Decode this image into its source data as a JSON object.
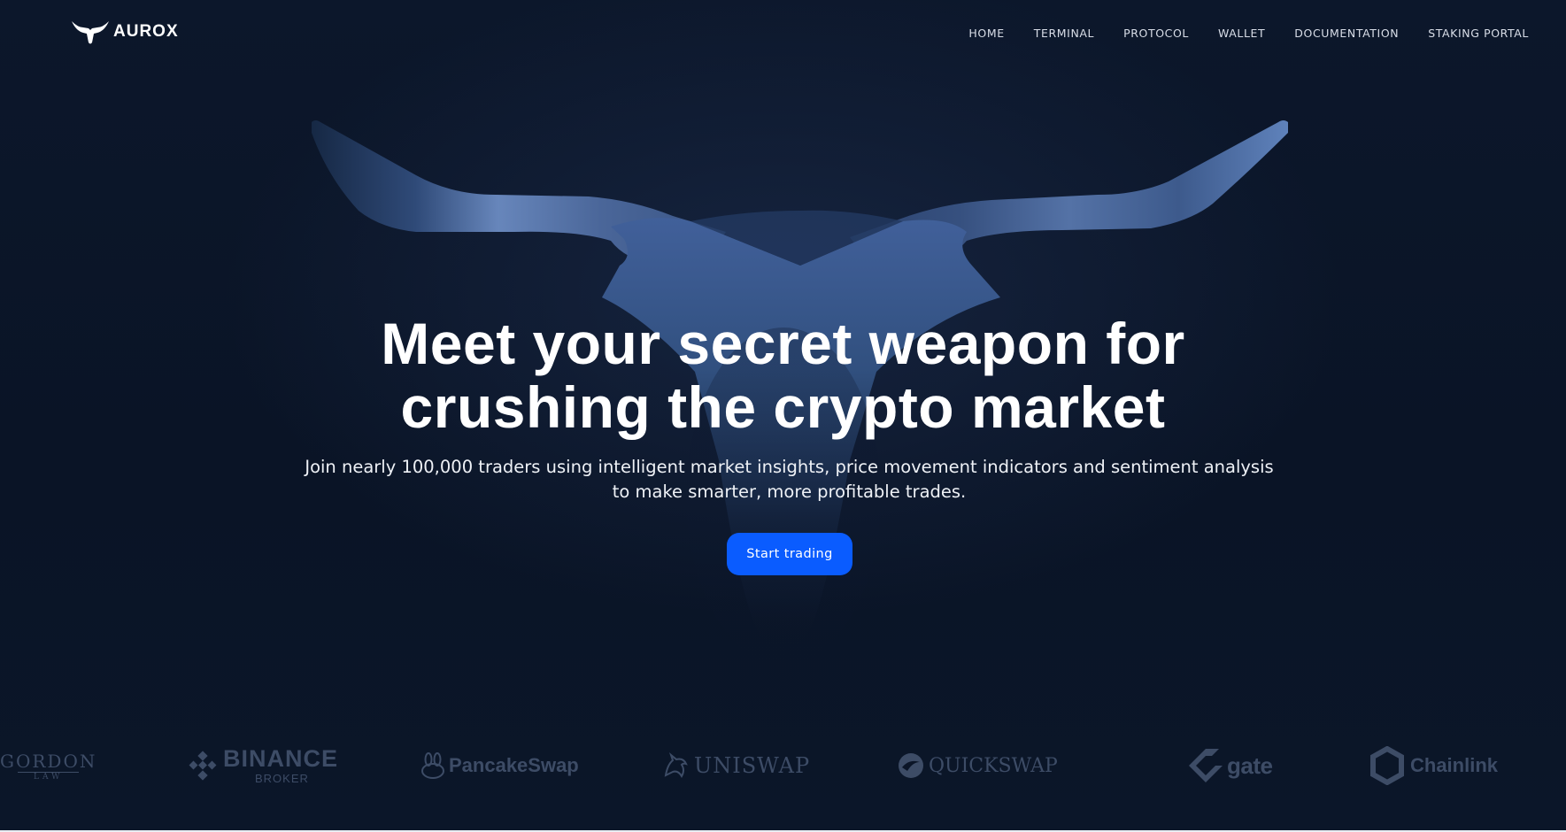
{
  "brand": {
    "name": "AUROX",
    "logo_icon": "bull-head-icon"
  },
  "nav": {
    "items": [
      {
        "label": "HOME"
      },
      {
        "label": "TERMINAL"
      },
      {
        "label": "PROTOCOL"
      },
      {
        "label": "WALLET"
      },
      {
        "label": "DOCUMENTATION"
      },
      {
        "label": "STAKING PORTAL"
      }
    ]
  },
  "hero": {
    "title_line1": "Meet your secret weapon for",
    "title_line2": "crushing the crypto market",
    "subtitle": "Join nearly 100,000 traders using intelligent market insights, price movement indicators and sentiment analysis to make smarter, more profitable trades.",
    "cta_label": "Start trading"
  },
  "partners": {
    "items": [
      {
        "name": "GORDON",
        "sub": "LAW",
        "icon": "gordon-law-logo"
      },
      {
        "name": "BINANCE",
        "sub": "BROKER",
        "icon": "binance-diamond-icon"
      },
      {
        "name": "PancakeSwap",
        "sub": "",
        "icon": "pancake-bunny-icon"
      },
      {
        "name": "UNISWAP",
        "sub": "",
        "icon": "unicorn-icon"
      },
      {
        "name": "QUICKSWAP",
        "sub": "",
        "icon": "quickswap-orb-icon"
      },
      {
        "name": "gate",
        "sub": "",
        "icon": "gate-hexagon-icon"
      },
      {
        "name": "Chainlink",
        "sub": "",
        "icon": "chainlink-hexagon-icon"
      }
    ]
  },
  "colors": {
    "background": "#0b1527",
    "accent": "#0a5cff",
    "bull": "#4f6fa3",
    "partner_logo": "#3d4c66"
  }
}
